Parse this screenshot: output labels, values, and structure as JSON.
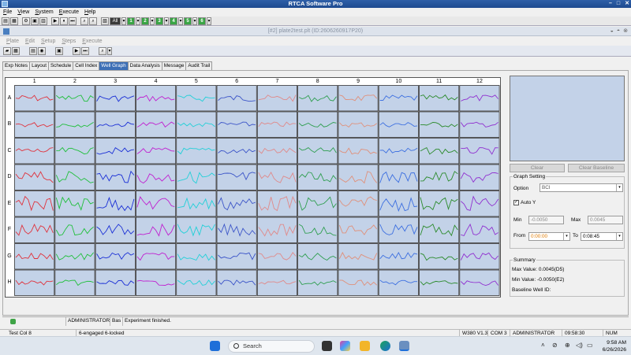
{
  "app": {
    "title": "RTCA Software Pro"
  },
  "menu": [
    "File",
    "View",
    "System",
    "Execute",
    "Help"
  ],
  "toolbar": {
    "all_label": "All",
    "plate_buttons": [
      "1",
      "2",
      "3",
      "4",
      "5",
      "6"
    ]
  },
  "document": {
    "title": "[#2] plate2test.plt (ID:2606260917P20)"
  },
  "submenu": [
    "Plate",
    "Edit",
    "Setup",
    "Steps",
    "Execute"
  ],
  "tabs": [
    {
      "label": "Exp Notes",
      "active": false
    },
    {
      "label": "Layout",
      "active": false
    },
    {
      "label": "Schedule",
      "active": false
    },
    {
      "label": "Cell Index",
      "active": false
    },
    {
      "label": "Well Graph",
      "active": true
    },
    {
      "label": "Data Analysis",
      "active": false
    },
    {
      "label": "Message",
      "active": false
    },
    {
      "label": "Audit Trail",
      "active": false
    }
  ],
  "grid": {
    "columns": [
      "1",
      "2",
      "3",
      "4",
      "5",
      "6",
      "7",
      "8",
      "9",
      "10",
      "11",
      "12"
    ],
    "rows": [
      "A",
      "B",
      "C",
      "D",
      "E",
      "F",
      "G",
      "H"
    ],
    "series_colors": [
      "#e0323c",
      "#1fbf3a",
      "#1a2fd6",
      "#c020d0",
      "#22d0d8",
      "#3c55c8",
      "#e08a8a",
      "#2f9e50",
      "#e0907a",
      "#3c6fe0",
      "#2a8a2a",
      "#9030d0"
    ],
    "row_amplitudes": [
      0.25,
      0.2,
      0.25,
      0.45,
      0.55,
      0.45,
      0.3,
      0.2
    ]
  },
  "side": {
    "clear_label": "Clear",
    "clear_baseline_label": "Clear Baseline",
    "graph_setting": {
      "title": "Graph Setting",
      "option_label": "Option",
      "option_value": "BCI",
      "auto_y_label": "Auto Y",
      "auto_y_checked": true,
      "min_label": "Min",
      "min_value": "-0.0050",
      "max_label": "Max",
      "max_value": "0.0045",
      "from_label": "From",
      "from_value": "0:00:00",
      "to_label": "To",
      "to_value": "0:08:45"
    },
    "summary": {
      "title": "Summary",
      "max_value": "Max Value: 0.0045(D5)",
      "min_value": "Min Value: -0.0050(E2)",
      "baseline": "Baseline Well ID:"
    }
  },
  "statusbar": {
    "user": "ADMINISTRATOR",
    "mode": "Bas",
    "message": "Experiment finished."
  },
  "statusbar2": {
    "test": "Test Col 8",
    "engaged": "6-engaged  6-locked",
    "version": "W380 V1.3",
    "port": "COM 3",
    "user": "ADMINISTRATOR",
    "time": "09:58:30",
    "num": "NUM"
  },
  "taskbar": {
    "search_placeholder": "Search",
    "time": "9:58 AM",
    "date": "6/26/2026"
  }
}
